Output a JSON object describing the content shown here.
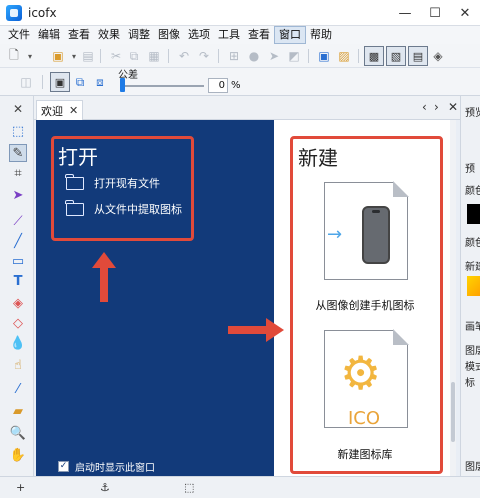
{
  "window": {
    "title": "icofx",
    "minimize": "—",
    "maximize": "☐",
    "close": "✕"
  },
  "menu": [
    "文件",
    "编辑",
    "查看",
    "效果",
    "调整",
    "图像",
    "选项",
    "工具",
    "查看",
    "窗口",
    "帮助"
  ],
  "menu_active_index": 9,
  "toolbar2": {
    "tolerance_label": "公差",
    "tolerance_value": "0",
    "tolerance_unit": "%",
    "tolerance_slider": 0
  },
  "tab": {
    "label": "欢迎",
    "close": "✕",
    "prev": "‹",
    "next": "›",
    "close_all": "✕"
  },
  "welcome": {
    "open_title": "打开",
    "open_items": [
      "打开现有文件",
      "从文件中提取图标"
    ],
    "new_title": "新建",
    "cards": [
      {
        "label": "从图像创建手机图标",
        "icon": "phone-icon"
      },
      {
        "label": "新建图标库",
        "icon": "ico-library-icon",
        "badge": "ICO"
      }
    ],
    "show_on_startup": "启动时显示此窗口",
    "show_on_startup_checked": true
  },
  "right_panel": {
    "items": [
      "预览",
      "预",
      "颜色",
      "颜色",
      "新建",
      "画笔",
      "图层",
      "模式",
      "标",
      "图层"
    ]
  },
  "colors": {
    "accent": "#e14a3a",
    "welcome_bg": "#123a7a",
    "highlight": "#1e7be6"
  },
  "tools": [
    "marquee-tool",
    "magic-wand-tool",
    "crop-tool",
    "selection-tool",
    "brush-tool",
    "line-tool",
    "rect-tool",
    "text-tool",
    "fill-tool",
    "eraser-tool",
    "blur-tool",
    "smudge-tool",
    "eyedropper-tool",
    "ruler-tool",
    "zoom-tool",
    "hand-tool"
  ]
}
